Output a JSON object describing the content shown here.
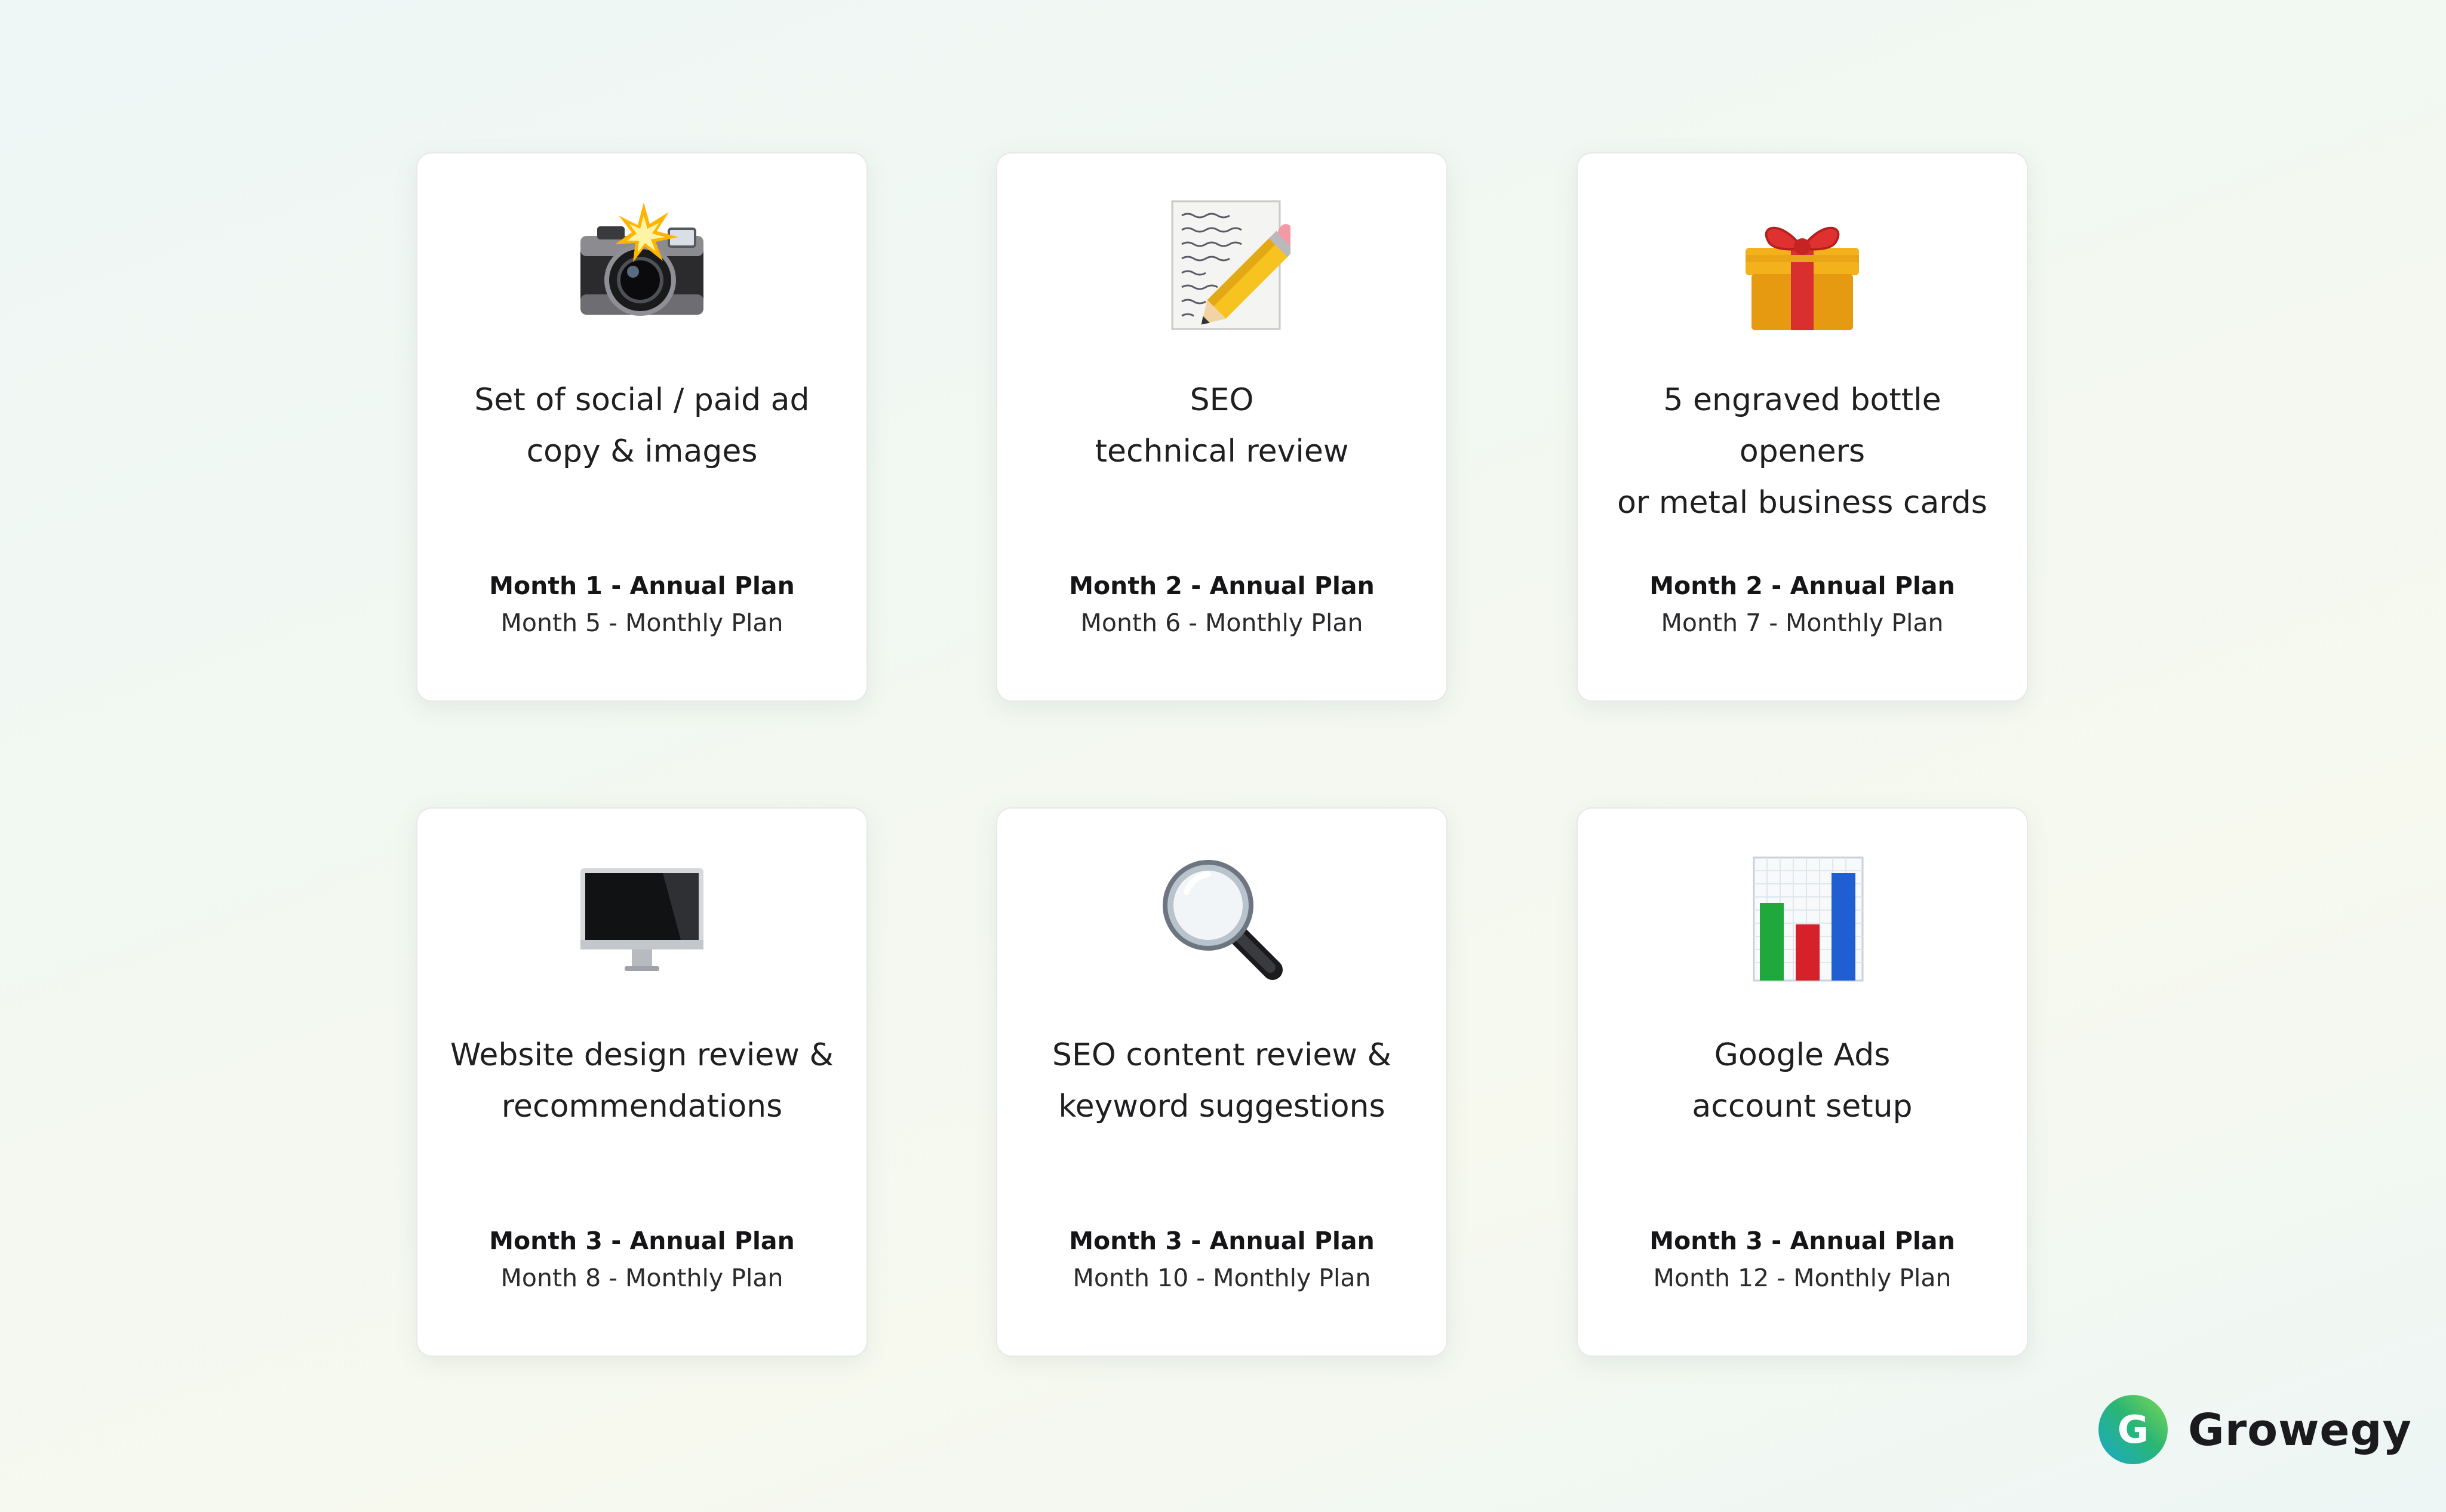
{
  "cards": [
    {
      "icon": "camera-with-flash-icon",
      "title_lines": [
        "Set of social / paid ad",
        "copy & images"
      ],
      "annual": "Month 1 - Annual Plan",
      "monthly": "Month 5 - Monthly Plan"
    },
    {
      "icon": "memo-icon",
      "title_lines": [
        "SEO",
        "technical review"
      ],
      "annual": "Month 2 - Annual Plan",
      "monthly": "Month 6 - Monthly Plan"
    },
    {
      "icon": "wrapped-gift-icon",
      "title_lines": [
        "5 engraved bottle openers",
        "or metal business cards"
      ],
      "annual": "Month 2 - Annual Plan",
      "monthly": "Month 7 - Monthly Plan"
    },
    {
      "icon": "desktop-computer-icon",
      "title_lines": [
        "Website design review &",
        "recommendations"
      ],
      "annual": "Month 3 - Annual Plan",
      "monthly": "Month 8 - Monthly Plan"
    },
    {
      "icon": "magnifying-glass-icon",
      "title_lines": [
        "SEO content review &",
        "keyword suggestions"
      ],
      "annual": "Month 3 - Annual Plan",
      "monthly": "Month 10 - Monthly Plan"
    },
    {
      "icon": "bar-chart-icon",
      "title_lines": [
        "Google Ads",
        "account setup"
      ],
      "annual": "Month 3 - Annual Plan",
      "monthly": "Month 12 - Monthly Plan"
    }
  ],
  "brand": {
    "name": "Growegy",
    "logo_letter": "G",
    "colors": [
      "#2bb673",
      "#1aa9c9",
      "#7ed957"
    ]
  }
}
